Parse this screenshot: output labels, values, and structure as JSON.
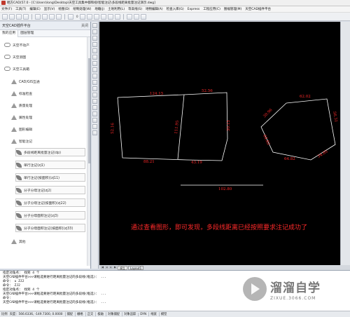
{
  "window": {
    "title": "晒方CAD(57.0 - [C:\\Users\\long\\Desktop\\天空工具集中都和视\\智能注记\\多段线距离批量注记演示.dwg]"
  },
  "menu": [
    "文件(F)",
    "工具(T)",
    "编辑(E)",
    "显示(V)",
    "绘图(D)",
    "绘制处理(W)",
    "地籍(J)",
    "土地利用(L)",
    "等高线(S)",
    "地物编辑(A)",
    "检查入库(G)",
    "Express",
    "工程应用(C)",
    "图幅管理(M)",
    "天空CAD插件平台"
  ],
  "toolbar": {
    "layer_label": "0"
  },
  "panel": {
    "title": "天空CAD插件平台",
    "close_label": "关闭",
    "tabs": [
      "我的应用",
      "图层管理"
    ],
    "items": [
      {
        "label": "天空不动产",
        "icon": "cloud-icon"
      },
      {
        "label": "天空测图",
        "icon": "cloud-icon"
      },
      {
        "label": "天空工具箱",
        "icon": "cloud-icon"
      },
      {
        "label": "CAD/GIS互通",
        "icon": "triangle-icon"
      },
      {
        "label": "标准检查",
        "icon": "triangle-icon"
      },
      {
        "label": "质量处理",
        "icon": "triangle-icon"
      },
      {
        "label": "属性处理",
        "icon": "triangle-icon"
      },
      {
        "label": "图形编辑",
        "icon": "triangle-icon"
      },
      {
        "label": "智能注记",
        "icon": "triangle-icon"
      },
      {
        "label": "多段线距离批量注记(dp)",
        "icon": "leaf-icon"
      },
      {
        "label": "单行注记(zj1)",
        "icon": "leaf-icon"
      },
      {
        "label": "单行注记(按面积)(zj11)",
        "icon": "leaf-icon"
      },
      {
        "label": "分子分母注记(zj2)",
        "icon": "leaf-icon"
      },
      {
        "label": "分子分母注记(按面积)(zj22)",
        "icon": "leaf-icon"
      },
      {
        "label": "分子分母面积注记(zj3)",
        "icon": "leaf-icon"
      },
      {
        "label": "分子分母面积注记(按面积)(zj33)",
        "icon": "leaf-icon"
      },
      {
        "label": "其他",
        "icon": "triangle-icon"
      }
    ]
  },
  "canvas": {
    "colors": {
      "lines": "#ffffff",
      "labels": "#ff2a2a",
      "background": "#000000"
    },
    "left_shape_labels": {
      "top_left": "124.15",
      "top_right": "52.56",
      "left_side": "52.16",
      "middle": "111.95",
      "right_side": "30.15",
      "bottom_left": "88.21",
      "bottom_right": "43.19"
    },
    "pentagon_labels": {
      "top": "62.02",
      "upper_right": "56.31",
      "upper_left": "30.96",
      "lower_left": "64.82",
      "bottom_right": "34.85"
    },
    "line_label": "102.80",
    "annotation": "通过查看图形，即可发现，多段线距离已经按照要求注记成功了"
  },
  "layout_tabs": [
    "模型",
    "Layout1"
  ],
  "command_lines": [
    "指定对角点： 找到 4 个",
    "天空CAD插件平台>>>请框选要进行距离批量注记的多段线(框选)： ...",
    "命令： u ZJ2",
    "命令： ZJ2",
    "指定对角点： 找到 4 个",
    "天空CAD插件平台>>>请框选要进行距离批量注记的多段线(框选)： ...",
    "命令：",
    "天空CAD插件平台>>>请框选要进行距离批量注记的多段线(框选)： ..."
  ],
  "status": {
    "scale": "比例",
    "coord_label": "天度：566.6336, -149.7300, 0.0000",
    "buttons": [
      "捕捉",
      "栅格",
      "正交",
      "极轴",
      "对象捕捉",
      "对象追踪",
      "DYN",
      "线宽",
      "模型"
    ]
  },
  "watermark": {
    "main": "溜溜自学",
    "sub": "ZIXUE.3066.COM"
  }
}
